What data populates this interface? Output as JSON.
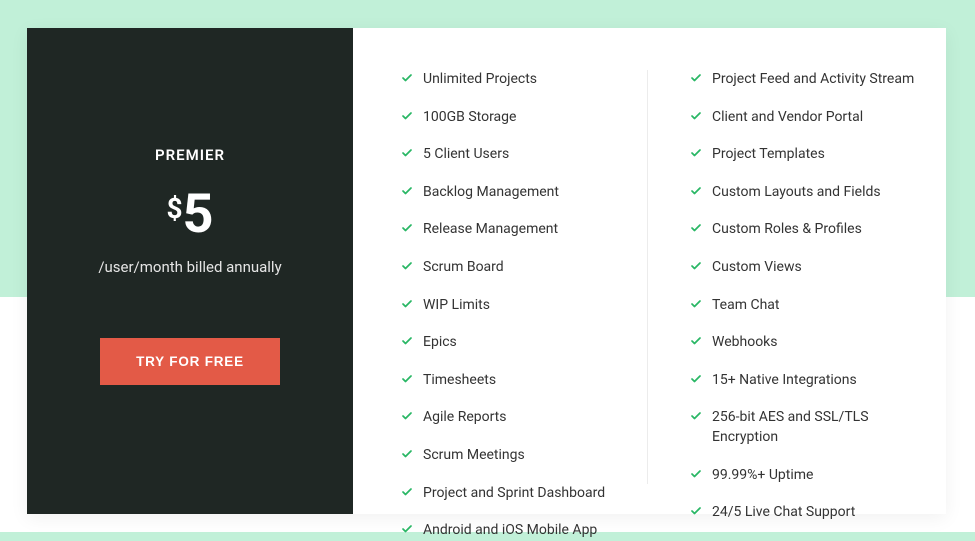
{
  "plan": {
    "name": "PREMIER",
    "currency": "$",
    "price": "5",
    "billing": "/user/month billed annually",
    "cta": "TRY FOR FREE"
  },
  "features_col1": [
    "Unlimited Projects",
    "100GB Storage",
    "5 Client Users",
    "Backlog Management",
    "Release Management",
    "Scrum Board",
    "WIP Limits",
    "Epics",
    "Timesheets",
    "Agile Reports",
    "Scrum Meetings",
    "Project and Sprint Dashboard",
    "Android and iOS Mobile App"
  ],
  "features_col2": [
    "Project Feed and Activity Stream",
    "Client and Vendor Portal",
    "Project Templates",
    "Custom Layouts and Fields",
    "Custom Roles & Profiles",
    "Custom Views",
    "Team Chat",
    "Webhooks",
    "15+ Native Integrations",
    "256-bit AES and SSL/TLS Encryption",
    "99.99%+ Uptime",
    "24/5 Live Chat Support"
  ],
  "colors": {
    "accent": "#e35a47",
    "check": "#29b765"
  }
}
